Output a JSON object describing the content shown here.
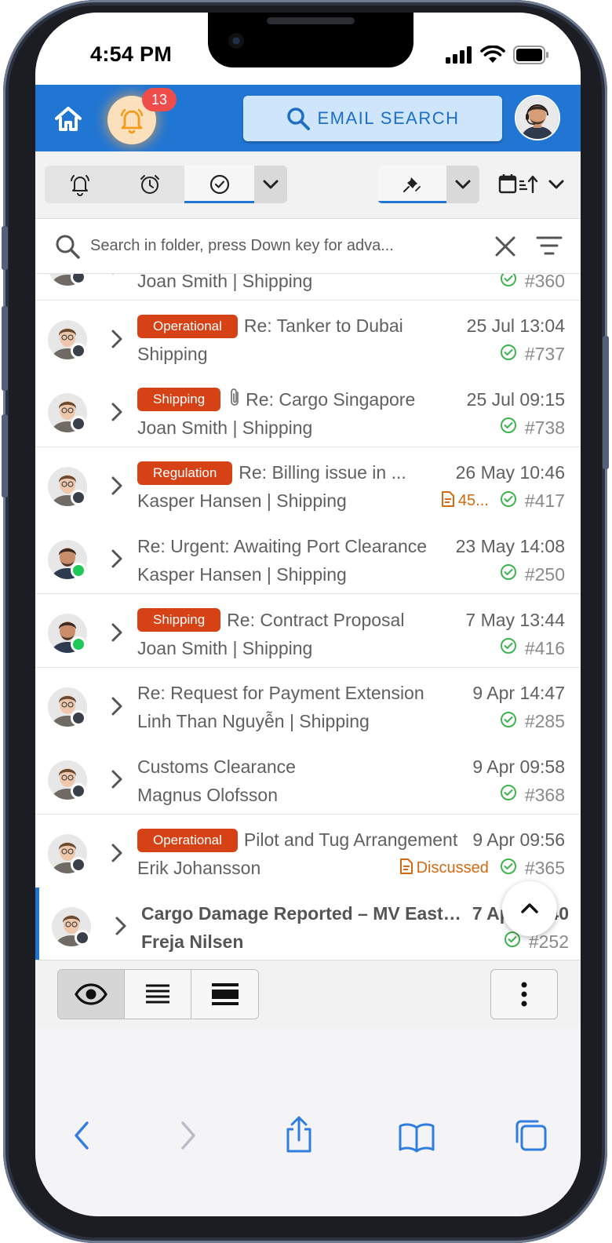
{
  "status_bar": {
    "time": "4:54 PM"
  },
  "header": {
    "notification_count": "13",
    "email_search_label": "EMAIL SEARCH"
  },
  "toolbar": {
    "tabs": [
      "reminder-bell",
      "alarm-clock",
      "completed-check"
    ],
    "active_tab": "completed-check",
    "view_filter": "pin",
    "sort": "date-ascending"
  },
  "search": {
    "placeholder": "Search in folder, press Down key for adva..."
  },
  "emails": [
    {
      "tag": "",
      "subject": "",
      "date": "",
      "sender": "Joan Smith | Shipping",
      "note": "",
      "id": "#360",
      "status": "offline",
      "partial": true
    },
    {
      "tag": "Operational",
      "subject": "Re: Tanker to Dubai",
      "date": "25 Jul 13:04",
      "sender": "Shipping",
      "note": "",
      "id": "#737",
      "status": "offline"
    },
    {
      "tag": "Shipping",
      "subject": "Re: Cargo Singapore",
      "date": "25 Jul 09:15",
      "sender": "Joan Smith | Shipping",
      "note": "",
      "id": "#738",
      "status": "offline",
      "attachment": true
    },
    {
      "tag": "Regulation",
      "subject": "Re: Billing issue in ...",
      "date": "26 May 10:46",
      "sender": "Kasper Hansen | Shipping",
      "note": "45...",
      "id": "#417",
      "status": "offline"
    },
    {
      "tag": "",
      "subject": "Re: Urgent: Awaiting Port Clearance",
      "date": "23 May 14:08",
      "sender": "Kasper Hansen | Shipping",
      "note": "",
      "id": "#250",
      "status": "online"
    },
    {
      "tag": "Shipping",
      "subject": "Re: Contract Proposal",
      "date": "7 May 13:44",
      "sender": "Joan Smith | Shipping",
      "note": "",
      "id": "#416",
      "status": "online"
    },
    {
      "tag": "",
      "subject": "Re: Request for Payment Extension",
      "date": "9 Apr 14:47",
      "sender": "Linh Than Nguyễn | Shipping",
      "note": "",
      "id": "#285",
      "status": "offline"
    },
    {
      "tag": "",
      "subject": "Customs Clearance",
      "date": "9 Apr 09:58",
      "sender": "Magnus Olofsson",
      "note": "",
      "id": "#368",
      "status": "offline"
    },
    {
      "tag": "Operational",
      "subject": "Pilot and Tug Arrangement",
      "date": "9 Apr 09:56",
      "sender": "Erik Johansson",
      "note": "Discussed",
      "id": "#365",
      "status": "offline"
    },
    {
      "tag": "",
      "subject": "Cargo Damage Reported – MV Eastern Star",
      "date": "7 Apr 09:40",
      "sender": "Freja Nilsen",
      "note": "",
      "id": "#252",
      "status": "offline",
      "bold": true,
      "selected": true
    }
  ],
  "bottom_bar": {
    "views": [
      "preview",
      "compact",
      "comfortable"
    ],
    "active_view": "preview"
  },
  "colors": {
    "header_blue": "#2176d3",
    "tag_red": "#d64215",
    "note_orange": "#d46a10",
    "check_green": "#3fb34f",
    "badge_red": "#ef4c4c",
    "online_green": "#1ec95a",
    "offline_dark": "#3a3f4a"
  }
}
